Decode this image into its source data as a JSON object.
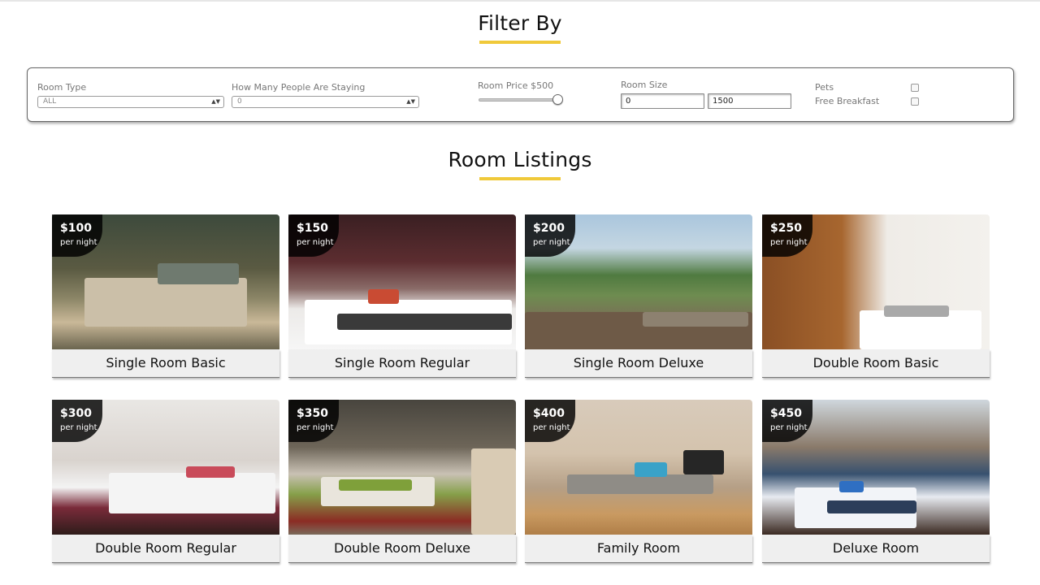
{
  "filter_section": {
    "title": "Filter By"
  },
  "filters": {
    "room_type": {
      "label": "Room Type",
      "value": "ALL"
    },
    "guests": {
      "label": "How Many People Are Staying",
      "value": "0"
    },
    "price": {
      "label": "Room Price $500",
      "level_fraction": 1.0
    },
    "size": {
      "label": "Room Size",
      "min": "0",
      "max": "1500"
    },
    "pets": {
      "label": "Pets",
      "checked": false
    },
    "breakfast": {
      "label": "Free Breakfast",
      "checked": false
    }
  },
  "listings_section": {
    "title": "Room Listings"
  },
  "rooms": [
    {
      "price": "$100",
      "per": "per night",
      "name": "Single Room Basic"
    },
    {
      "price": "$150",
      "per": "per night",
      "name": "Single Room Regular"
    },
    {
      "price": "$200",
      "per": "per night",
      "name": "Single Room Deluxe"
    },
    {
      "price": "$250",
      "per": "per night",
      "name": "Double Room Basic"
    },
    {
      "price": "$300",
      "per": "per night",
      "name": "Double Room Regular"
    },
    {
      "price": "$350",
      "per": "per night",
      "name": "Double Room Deluxe"
    },
    {
      "price": "$400",
      "per": "per night",
      "name": "Family Room"
    },
    {
      "price": "$450",
      "per": "per night",
      "name": "Deluxe Room"
    }
  ],
  "colors": {
    "accent_underline": "#f0c93a",
    "caption_bg": "#efefef",
    "price_tag_bg": "#000000"
  },
  "icons": {
    "select_caret": "updown-caret-icon"
  }
}
